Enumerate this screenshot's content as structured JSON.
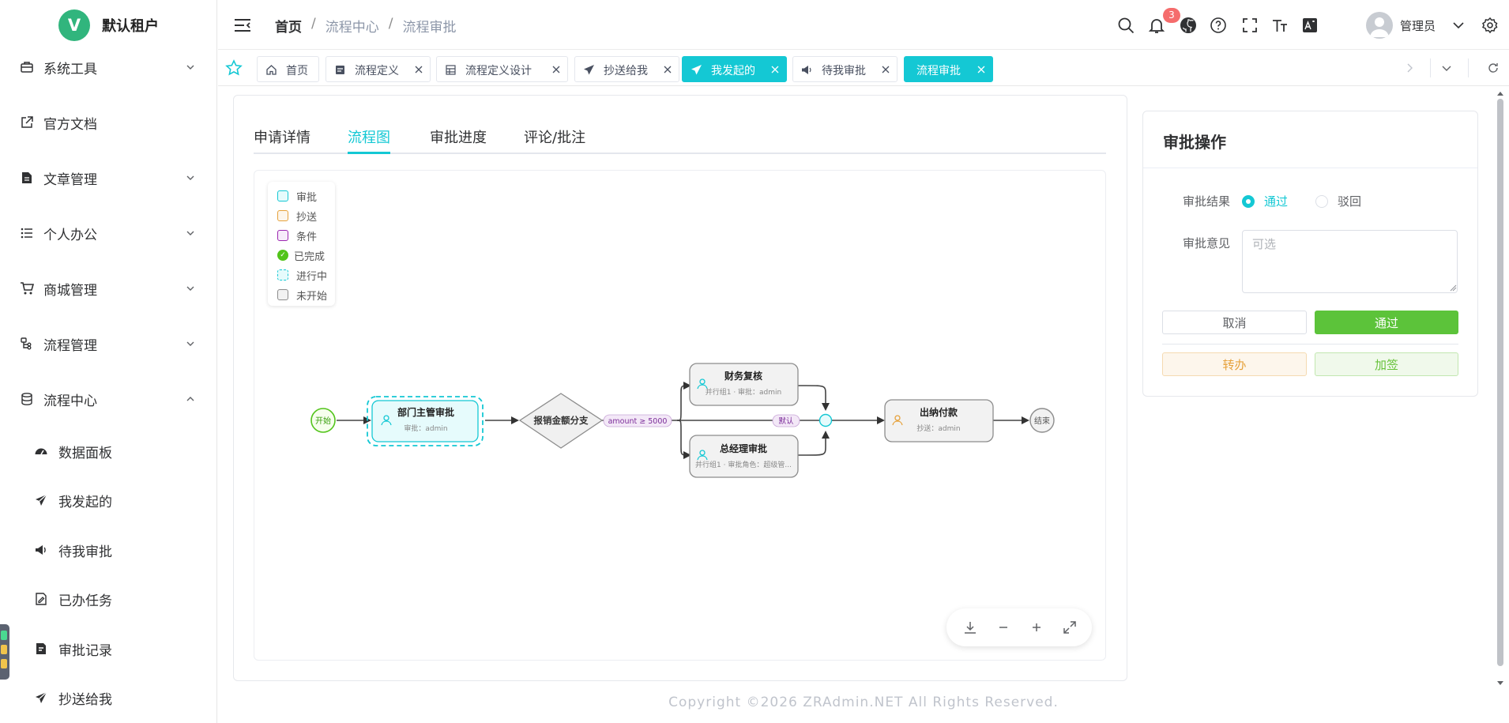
{
  "app": {
    "logo_letter": "V",
    "tenant_name": "默认租户",
    "user_name": "管理员",
    "notification_count": "3"
  },
  "sidebar": {
    "items": [
      {
        "label": "系统工具",
        "icon": "toolbox-icon",
        "expandable": true
      },
      {
        "label": "官方文档",
        "icon": "external-link-icon",
        "expandable": false
      },
      {
        "label": "文章管理",
        "icon": "document-icon",
        "expandable": true
      },
      {
        "label": "个人办公",
        "icon": "list-icon",
        "expandable": true
      },
      {
        "label": "商城管理",
        "icon": "cart-icon",
        "expandable": true
      },
      {
        "label": "流程管理",
        "icon": "flow-icon",
        "expandable": true
      },
      {
        "label": "流程中心",
        "icon": "database-icon",
        "expandable": true,
        "expanded": true
      }
    ],
    "sub_items": [
      {
        "label": "数据面板",
        "icon": "dashboard-icon"
      },
      {
        "label": "我发起的",
        "icon": "send-icon"
      },
      {
        "label": "待我审批",
        "icon": "megaphone-icon"
      },
      {
        "label": "已办任务",
        "icon": "edit-doc-icon"
      },
      {
        "label": "审批记录",
        "icon": "record-icon"
      },
      {
        "label": "抄送给我",
        "icon": "send-icon"
      }
    ]
  },
  "breadcrumb": {
    "home": "首页",
    "sep": "/",
    "level1": "流程中心",
    "level2": "流程审批"
  },
  "tabs": [
    {
      "label": "首页",
      "icon": "home-icon",
      "closable": false,
      "active": false
    },
    {
      "label": "流程定义",
      "icon": "definition-icon",
      "closable": true,
      "active": false
    },
    {
      "label": "流程定义设计",
      "icon": "grid-icon",
      "closable": true,
      "active": false
    },
    {
      "label": "抄送给我",
      "icon": "send-icon",
      "closable": true,
      "active": false
    },
    {
      "label": "我发起的",
      "icon": "send-icon",
      "closable": true,
      "active": true
    },
    {
      "label": "待我审批",
      "icon": "megaphone-icon",
      "closable": true,
      "active": false
    },
    {
      "label": "流程审批",
      "icon": "",
      "closable": true,
      "active": true
    }
  ],
  "subtabs": {
    "detail": "申请详情",
    "flowchart": "流程图",
    "progress": "审批进度",
    "comments": "评论/批注"
  },
  "legend": {
    "approve": "审批",
    "cc": "抄送",
    "condition": "条件",
    "done": "已完成",
    "done_mark": "✓",
    "in_progress": "进行中",
    "not_started": "未开始"
  },
  "flow": {
    "start": "开始",
    "end": "结束",
    "node_dept": {
      "title": "部门主管审批",
      "sub": "审批：admin"
    },
    "branch": "报销金额分支",
    "condition_label": "amount ≥ 5000",
    "default_label": "默认",
    "node_finance": {
      "title": "财务复核",
      "sub": "并行组1 · 审批：admin"
    },
    "node_gm": {
      "title": "总经理审批",
      "sub": "并行组1 · 审批角色：超级管..."
    },
    "node_cashier": {
      "title": "出纳付款",
      "sub": "抄送：admin"
    }
  },
  "colors": {
    "primary": "#14c8d4",
    "approve": "#14c8d4",
    "cc": "#e6a23c",
    "condition": "#9c27b0",
    "done": "#52c41a",
    "pass_button": "#5cc33a",
    "badge": "#f56c6c"
  },
  "approval": {
    "title": "审批操作",
    "result_label": "审批结果",
    "opt_pass": "通过",
    "opt_reject": "驳回",
    "selected": "通过",
    "comment_label": "审批意见",
    "comment_placeholder": "可选",
    "cancel": "取消",
    "submit": "通过",
    "transfer": "转办",
    "add_sign": "加签"
  },
  "footer": "Copyright ©2026 ZRAdmin.NET All Rights Reserved."
}
